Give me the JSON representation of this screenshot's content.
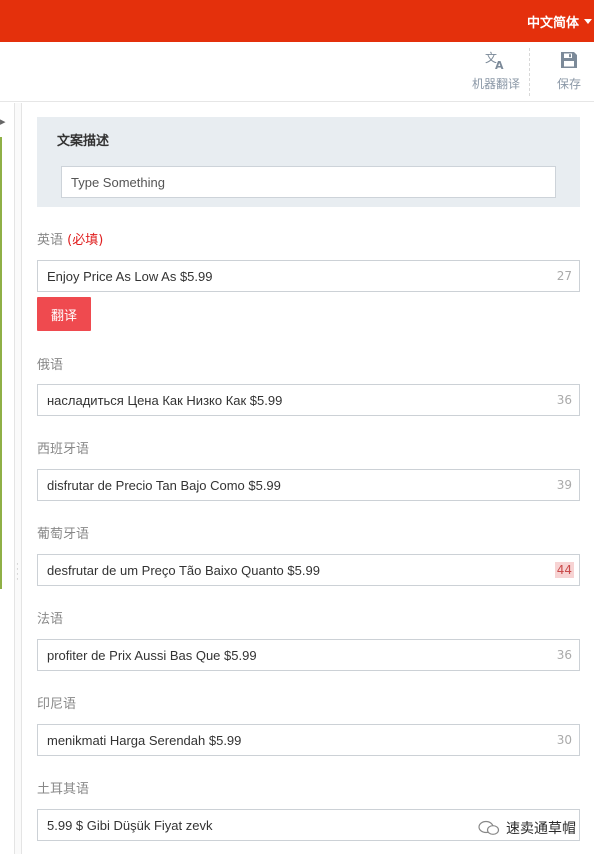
{
  "header": {
    "language_switch": "中文简体",
    "accent_color": "#e4300c"
  },
  "toolbar": {
    "translate_label": "机器翻译",
    "save_label": "保存"
  },
  "description": {
    "title": "文案描述",
    "placeholder": "Type Something"
  },
  "english": {
    "label": "英语",
    "required": "(必填)",
    "value": "Enjoy Price As Low As $5.99",
    "count": "27",
    "translate_button": "翻译"
  },
  "translations": [
    {
      "label": "俄语",
      "value": "насладиться Цена Как Низко Как $5.99",
      "count": "36",
      "over_limit": false
    },
    {
      "label": "西班牙语",
      "value": "disfrutar de Precio Tan Bajo Como $5.99",
      "count": "39",
      "over_limit": false
    },
    {
      "label": "葡萄牙语",
      "value": "desfrutar de um Preço Tão Baixo Quanto $5.99",
      "count": "44",
      "over_limit": true
    },
    {
      "label": "法语",
      "value": "profiter de Prix Aussi Bas Que $5.99",
      "count": "36",
      "over_limit": false
    },
    {
      "label": "印尼语",
      "value": "menikmati Harga Serendah $5.99",
      "count": "30",
      "over_limit": false
    },
    {
      "label": "土耳其语",
      "value": "5.99 $ Gibi Düşük Fiyat zevk",
      "count": "",
      "over_limit": false
    }
  ],
  "watermark": "速卖通草帽"
}
